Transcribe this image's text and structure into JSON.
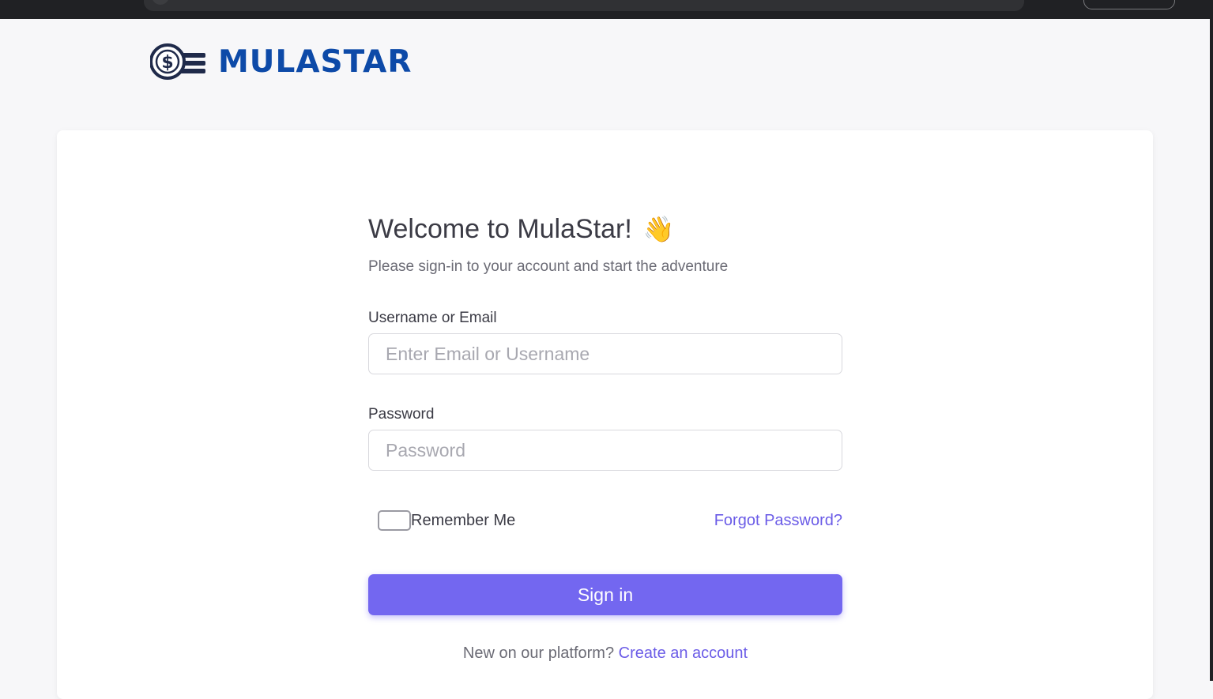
{
  "brand": {
    "name": "MULASTAR",
    "color": "#0d4aa8"
  },
  "login": {
    "title": "Welcome to MulaStar!",
    "wave_emoji": "👋",
    "subtitle": "Please sign-in to your account and start the adventure",
    "username_label": "Username or Email",
    "username_placeholder": "Enter Email or Username",
    "password_label": "Password",
    "password_placeholder": "Password",
    "remember_label": "Remember Me",
    "forgot_link": "Forgot Password?",
    "signin_button": "Sign in",
    "footer_text": "New on our platform?",
    "create_account_link": "Create an account"
  },
  "colors": {
    "accent": "#7367f0",
    "link": "#6b5ce7"
  },
  "icons": {
    "logo": "dollar-coin-icon"
  }
}
